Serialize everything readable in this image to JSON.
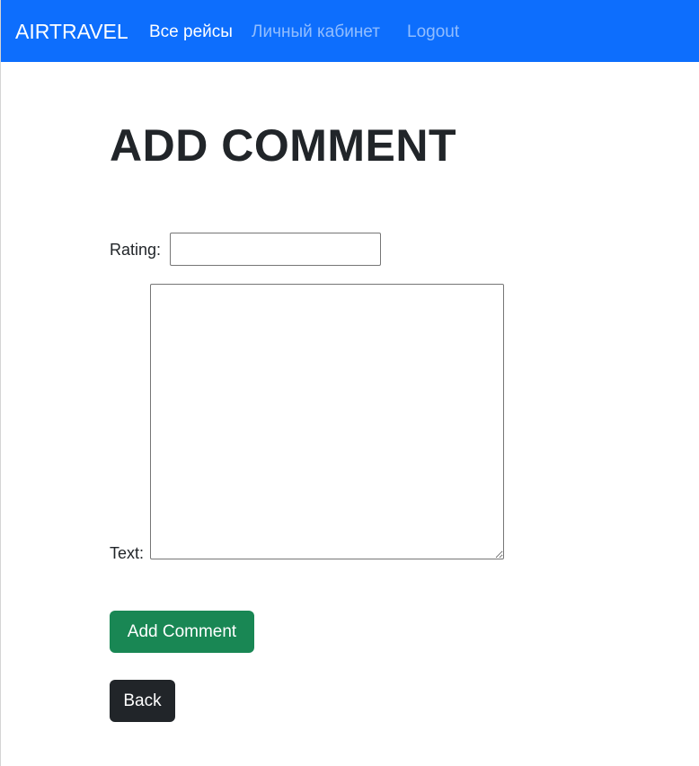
{
  "navbar": {
    "brand": "AIRTRAVEL",
    "links": [
      {
        "label": "Все рейсы",
        "active": true
      },
      {
        "label": "Личный кабинет",
        "active": false
      },
      {
        "label": "Logout",
        "active": false
      }
    ]
  },
  "main": {
    "title": "ADD COMMENT",
    "form": {
      "rating_label": "Rating:",
      "rating_value": "",
      "text_label": "Text:",
      "text_value": "",
      "submit_label": "Add Comment"
    },
    "back_label": "Back"
  },
  "colors": {
    "navbar_bg": "#0d6efd",
    "success_button": "#198754",
    "dark_button": "#212529"
  }
}
